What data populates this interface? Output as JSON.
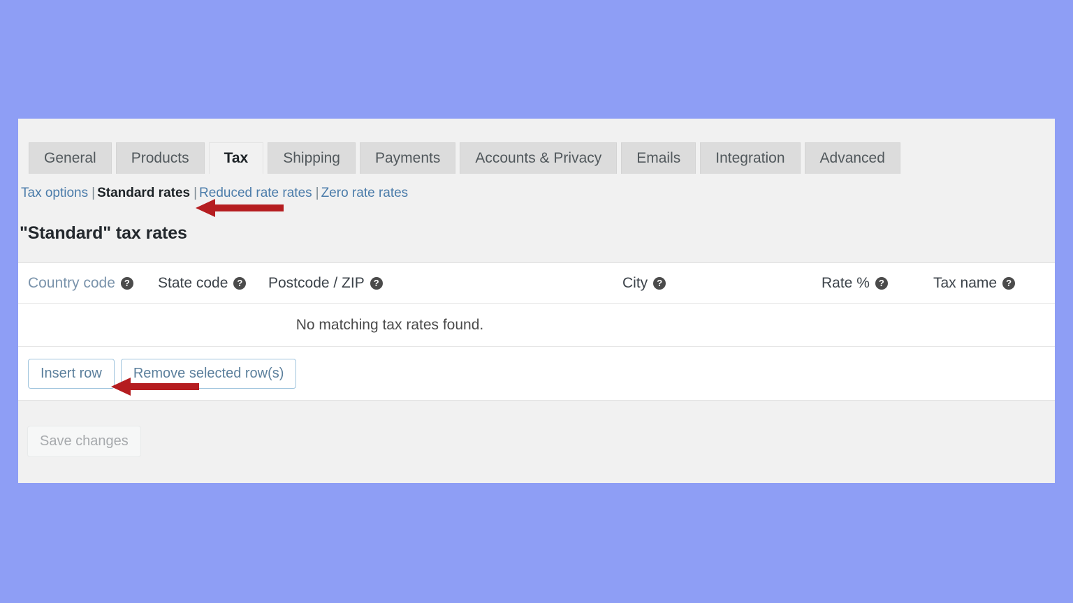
{
  "background_color": "#8e9ef5",
  "panel": {
    "background_color": "#f1f1f1"
  },
  "tabs": [
    {
      "label": "General",
      "active": false
    },
    {
      "label": "Products",
      "active": false
    },
    {
      "label": "Tax",
      "active": true
    },
    {
      "label": "Shipping",
      "active": false
    },
    {
      "label": "Payments",
      "active": false
    },
    {
      "label": "Accounts & Privacy",
      "active": false
    },
    {
      "label": "Emails",
      "active": false
    },
    {
      "label": "Integration",
      "active": false
    },
    {
      "label": "Advanced",
      "active": false
    }
  ],
  "subnav": {
    "items": [
      {
        "label": "Tax options",
        "current": false
      },
      {
        "label": "Standard rates",
        "current": true
      },
      {
        "label": "Reduced rate rates",
        "current": false
      },
      {
        "label": "Zero rate rates",
        "current": false
      }
    ],
    "separator": "|"
  },
  "section": {
    "title": "\"Standard\" tax rates"
  },
  "table": {
    "columns": [
      {
        "label": "Country code",
        "help": "?",
        "sorted": true
      },
      {
        "label": "State code",
        "help": "?",
        "sorted": false
      },
      {
        "label": "Postcode / ZIP",
        "help": "?",
        "sorted": false
      },
      {
        "label": "City",
        "help": "?",
        "sorted": false
      },
      {
        "label": "Rate %",
        "help": "?",
        "sorted": false
      },
      {
        "label": "Tax name",
        "help": "?",
        "sorted": false
      }
    ],
    "empty_message": "No matching tax rates found.",
    "rows": []
  },
  "actions": {
    "insert_row_label": "Insert row",
    "remove_rows_label": "Remove selected row(s)"
  },
  "footer": {
    "save_label": "Save changes",
    "save_disabled": true
  },
  "annotations": {
    "arrow_color": "#b51d20",
    "arrow_1_target": "Standard rates",
    "arrow_2_target": "Insert row"
  }
}
